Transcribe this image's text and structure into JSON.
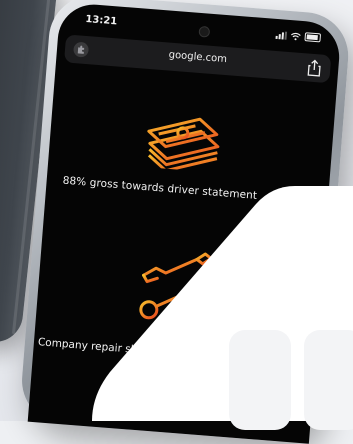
{
  "status_bar": {
    "time": "13:21"
  },
  "browser": {
    "url": "google.com"
  },
  "features": [
    {
      "label": "88% gross towards driver statement",
      "icon": "cash-stack-icon"
    },
    {
      "label": "Company repair sh",
      "icon": "tools-icon"
    }
  ],
  "colors": {
    "icon_gradient_start": "#f5b82b",
    "icon_gradient_end": "#e8461e",
    "screen": "#050505"
  }
}
